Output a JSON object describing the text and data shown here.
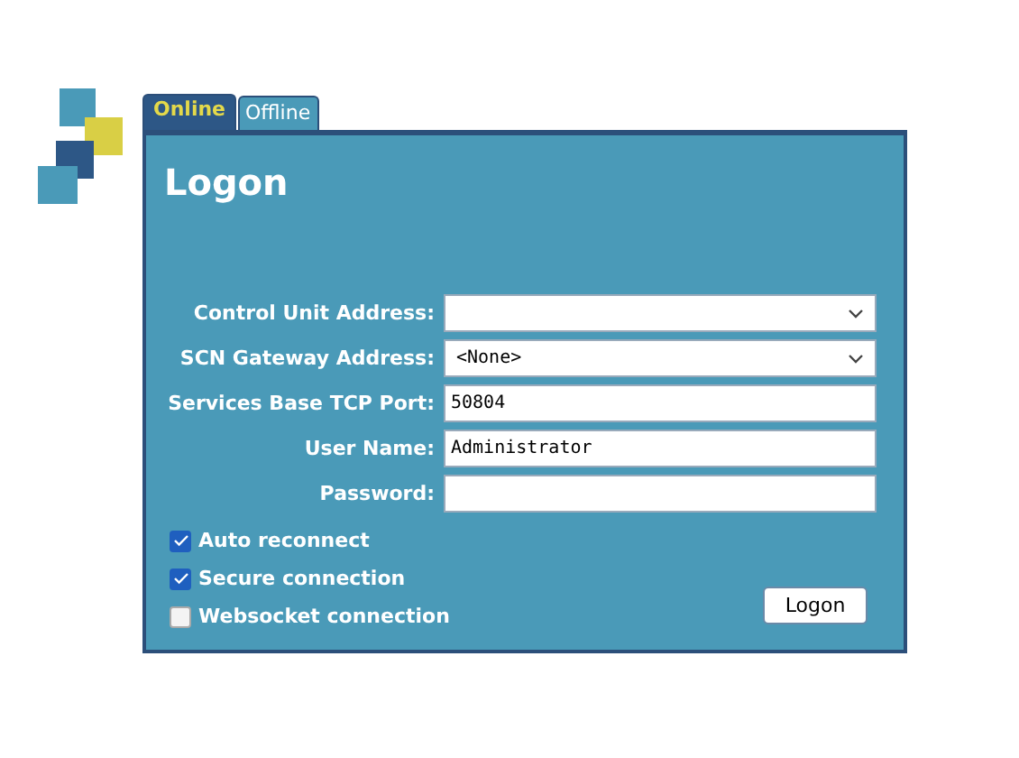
{
  "tabs": [
    {
      "label": "Online",
      "selected": true
    },
    {
      "label": "Offline",
      "selected": false
    }
  ],
  "title": "Logon",
  "fields": [
    {
      "label": "Control Unit Address:",
      "kind": "select"
    },
    {
      "label": "SCN Gateway Address:",
      "kind": "select",
      "value": "<None>"
    },
    {
      "label": "Services Base TCP Port:",
      "kind": "text",
      "value": "50804"
    },
    {
      "label": "User Name:",
      "kind": "text",
      "value": "Administrator"
    },
    {
      "label": "Password:",
      "kind": "password"
    }
  ],
  "options": [
    {
      "label": "Auto reconnect",
      "checked": true
    },
    {
      "label": "Secure connection",
      "checked": true
    },
    {
      "label": "Websocket connection",
      "checked": false
    }
  ],
  "button": "Logon"
}
